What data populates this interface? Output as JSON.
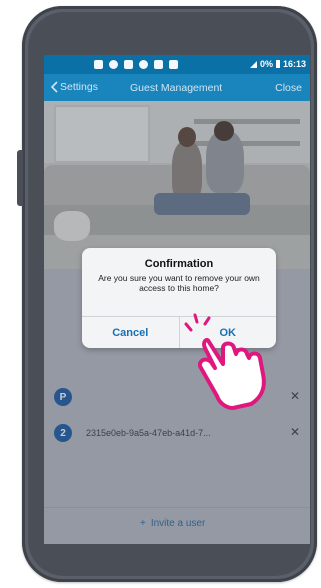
{
  "status_bar": {
    "battery": "0%",
    "time": "16:13"
  },
  "nav": {
    "back_label": "Settings",
    "title": "Guest Management",
    "close_label": "Close"
  },
  "guests": [
    {
      "avatar_letter": "P",
      "name": ""
    },
    {
      "avatar_letter": "2",
      "name": "2315e0eb-9a5a-47eb-a41d-7..."
    }
  ],
  "footer": {
    "invite_label": "Invite a user"
  },
  "dialog": {
    "title": "Confirmation",
    "message": "Are you sure you want to remove your own access to this home?",
    "cancel_label": "Cancel",
    "ok_label": "OK"
  },
  "colors": {
    "status_bar": "#0a70a6",
    "nav_bar": "#1a84bd",
    "accent": "#1a6fb4",
    "avatar": "#1f5fa8",
    "hand_outline": "#e0177f"
  },
  "icons": {
    "back": "chevron-left-icon",
    "remove": "close-icon",
    "invite": "plus-icon",
    "tap": "tap-hand-icon"
  }
}
